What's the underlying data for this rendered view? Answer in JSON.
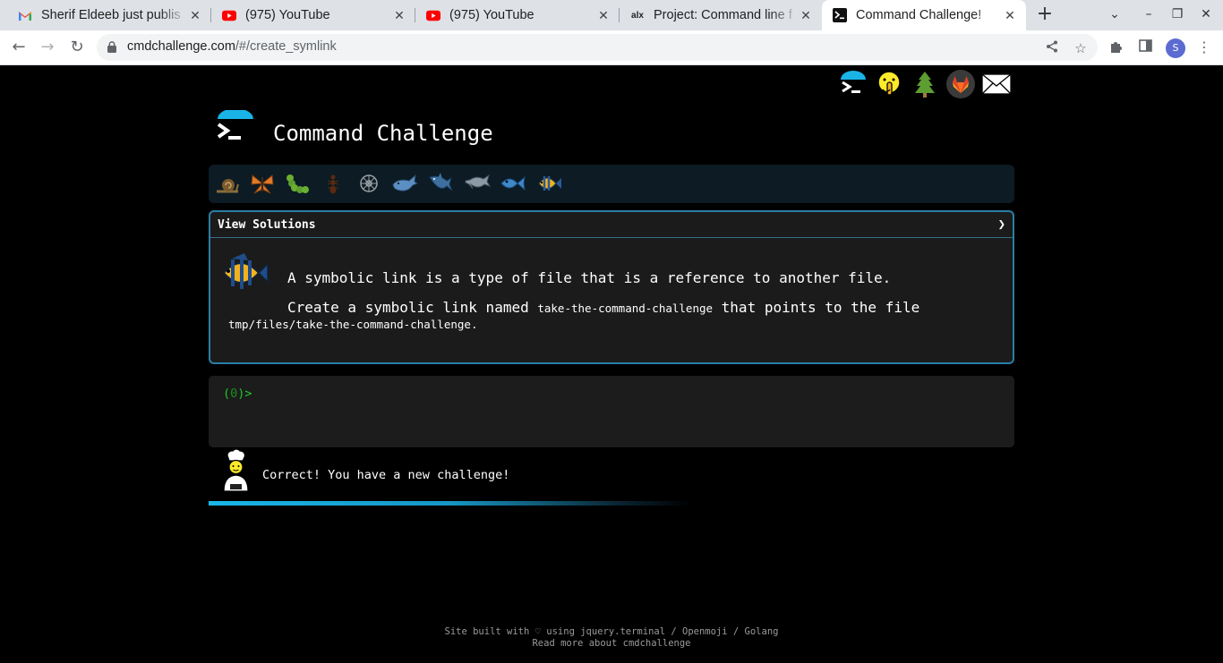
{
  "browser": {
    "tabs": [
      {
        "title": "Sherif Eldeeb just publis",
        "icon": "gmail-icon",
        "active": false
      },
      {
        "title": "(975) YouTube",
        "icon": "youtube-icon",
        "active": false
      },
      {
        "title": "(975) YouTube",
        "icon": "youtube-icon",
        "active": false
      },
      {
        "title": "Project: Command line f",
        "icon": "alx-icon",
        "active": false
      },
      {
        "title": "Command Challenge!",
        "icon": "terminal-icon",
        "active": true
      }
    ],
    "url_host": "cmdchallenge.com",
    "url_path": "/#/create_symlink",
    "profile_initial": "S",
    "alx_glyph": "alx"
  },
  "page": {
    "title": "Command Challenge",
    "solutions_label": "View Solutions",
    "chevron": "❯",
    "description": "A symbolic link is a type of file that is a reference to another file.",
    "task_prefix": "Create a symbolic link named ",
    "task_name": "take-the-command-challenge",
    "task_middle": " that points to the file",
    "task_path": "tmp/files/take-the-command-challenge",
    "task_suffix": ".",
    "prompt_open": "(",
    "prompt_count": "0",
    "prompt_close": ")>",
    "result_message": "Correct! You have a new challenge!",
    "progress": 0.6,
    "footer_line1": "Site built with ♡ using jquery.terminal / Openmoji / Golang",
    "footer_line2": "Read more about cmdchallenge",
    "level_icons": [
      "snail-icon",
      "butterfly-icon",
      "caterpillar-icon",
      "ant-icon",
      "wheel-icon",
      "whale-icon",
      "shark-icon",
      "dolphin-icon",
      "fish-icon",
      "tropical-fish-icon"
    ],
    "header_icons": [
      "terminal-logo-icon",
      "shushing-face-icon",
      "tree-icon",
      "gitlab-icon",
      "envelope-icon"
    ],
    "colors": {
      "accent": "#2a7fa5",
      "prompt_green": "#22c52a",
      "progress": "#19b6e8"
    }
  }
}
